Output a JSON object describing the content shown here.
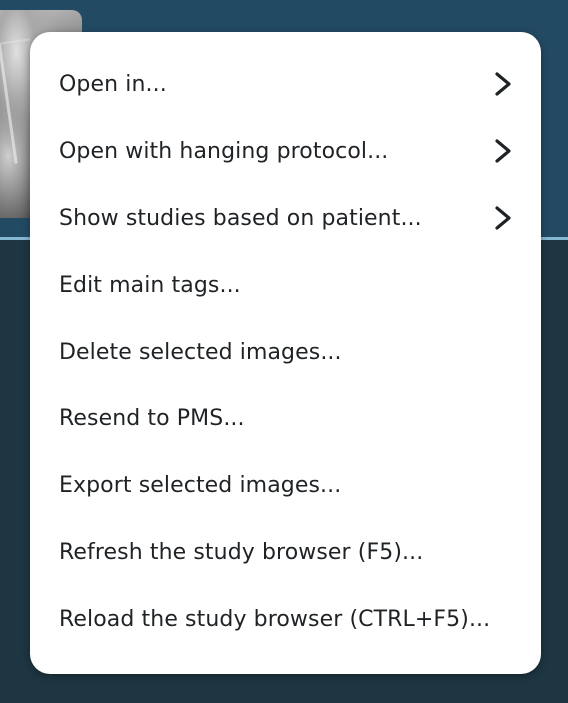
{
  "context_menu": {
    "items": [
      {
        "label": "Open in...",
        "has_submenu": true,
        "icon": "chevron-right-icon"
      },
      {
        "label": "Open with hanging protocol...",
        "has_submenu": true,
        "icon": "chevron-right-icon"
      },
      {
        "label": "Show studies based on patient...",
        "has_submenu": true,
        "icon": "chevron-right-icon"
      },
      {
        "label": "Edit main tags...",
        "has_submenu": false
      },
      {
        "label": "Delete selected images...",
        "has_submenu": false
      },
      {
        "label": "Resend to PMS...",
        "has_submenu": false
      },
      {
        "label": "Export selected images...",
        "has_submenu": false
      },
      {
        "label": "Refresh the study browser (F5)...",
        "has_submenu": false
      },
      {
        "label": "Reload the study browser (CTRL+F5)...",
        "has_submenu": false
      }
    ]
  },
  "colors": {
    "background_top": "#234a63",
    "background_bottom": "#1e3642",
    "divider": "#86b7d2",
    "menu_background": "#ffffff",
    "menu_text": "#1f2326"
  }
}
